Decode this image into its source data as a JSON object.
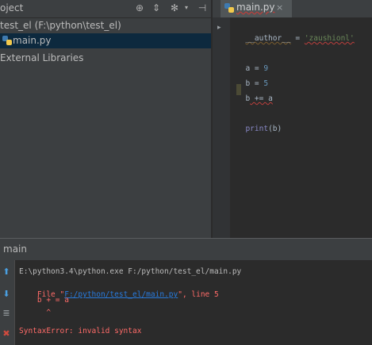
{
  "project_panel": {
    "title": "oject",
    "header_icons": [
      "crosshair-icon",
      "split-icon",
      "gear-icon",
      "collapse-icon"
    ],
    "tree": {
      "project_root": "test_el  (F:\\python\\test_el)",
      "file": "main.py",
      "external": "External Libraries"
    }
  },
  "editor": {
    "tab_label": "main.py",
    "tab_close": "×",
    "code": {
      "line1_a": "__author__",
      "line1_b": " = ",
      "line1_c": "'zaushionl'",
      "line2_a": "a = ",
      "line2_b": "9",
      "line3_a": "b = ",
      "line3_b": "5",
      "line4_a": "b",
      "line4_b": " += a",
      "line5_a": "print",
      "line5_b": "(b)"
    }
  },
  "run_panel": {
    "title": "main",
    "console": {
      "cmd": "E:\\python3.4\\python.exe F:/python/test_el/main.py",
      "file_prefix": "  File \"",
      "file_link": "F:/python/test_el/main.py",
      "file_suffix": "\", line 5",
      "code_line": "    b + = a",
      "caret": "      ^",
      "error": "SyntaxError: invalid syntax"
    }
  },
  "colors": {
    "accent": "#4b8eff",
    "error": "#ff6b68",
    "link": "#287bde"
  }
}
